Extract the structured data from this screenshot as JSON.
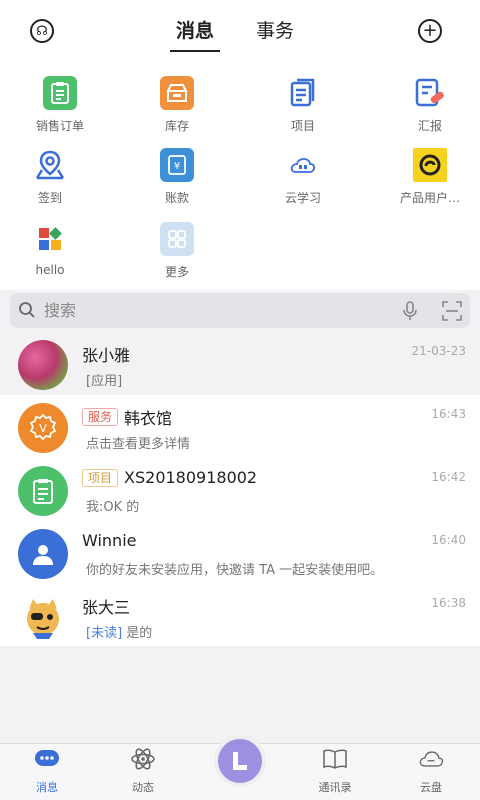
{
  "header": {
    "tabs": [
      {
        "label": "消息",
        "active": true
      },
      {
        "label": "事务",
        "active": false
      }
    ]
  },
  "apps": [
    {
      "label": "销售订单",
      "icon": "sales-order-icon",
      "color": "#4cc06a"
    },
    {
      "label": "库存",
      "icon": "inventory-icon",
      "color": "#f0903c"
    },
    {
      "label": "项目",
      "icon": "project-icon",
      "color": "#3a6fd8"
    },
    {
      "label": "汇报",
      "icon": "report-icon",
      "color": "#3a6fd8"
    },
    {
      "label": "签到",
      "icon": "checkin-icon",
      "color": "#3a6fd8"
    },
    {
      "label": "账款",
      "icon": "accounts-icon",
      "color": "#3d8fd8"
    },
    {
      "label": "云学习",
      "icon": "cloud-learning-icon",
      "color": "#3a6fd8"
    },
    {
      "label": "产品用户…",
      "icon": "product-user-icon",
      "color": "#f5d21e"
    },
    {
      "label": "hello",
      "icon": "hello-app-icon",
      "color": "#e04a3c"
    },
    {
      "label": "更多",
      "icon": "more-apps-icon",
      "color": "#9fc3e8"
    }
  ],
  "search": {
    "placeholder": "搜索"
  },
  "conversations": [
    {
      "name": "张小雅",
      "tag": "",
      "preview": "[应用]",
      "time": "21-03-23",
      "avatar": "photo-avatar"
    },
    {
      "name": "韩衣馆",
      "tag": "服务",
      "preview": "点击查看更多详情",
      "time": "16:43",
      "avatar": "vip-avatar"
    },
    {
      "name": "XS20180918002",
      "tag": "项目",
      "preview": "我:OK 的",
      "time": "16:42",
      "avatar": "clipboard-avatar"
    },
    {
      "name": "Winnie",
      "tag": "",
      "preview": "你的好友未安装应用，快邀请 TA 一起安装使用吧。",
      "time": "16:40",
      "avatar": "person-avatar"
    },
    {
      "name": "张大三",
      "tag": "",
      "unread_label": "[未读]",
      "preview": "是的",
      "time": "16:38",
      "avatar": "cartoon-avatar"
    }
  ],
  "bottom_nav": [
    {
      "label": "消息",
      "active": true
    },
    {
      "label": "动态",
      "active": false
    },
    {
      "label": "通讯录",
      "active": false
    },
    {
      "label": "云盘",
      "active": false
    }
  ],
  "colors": {
    "accent": "#3a6fd8",
    "center_button": "#9e8fe0"
  }
}
